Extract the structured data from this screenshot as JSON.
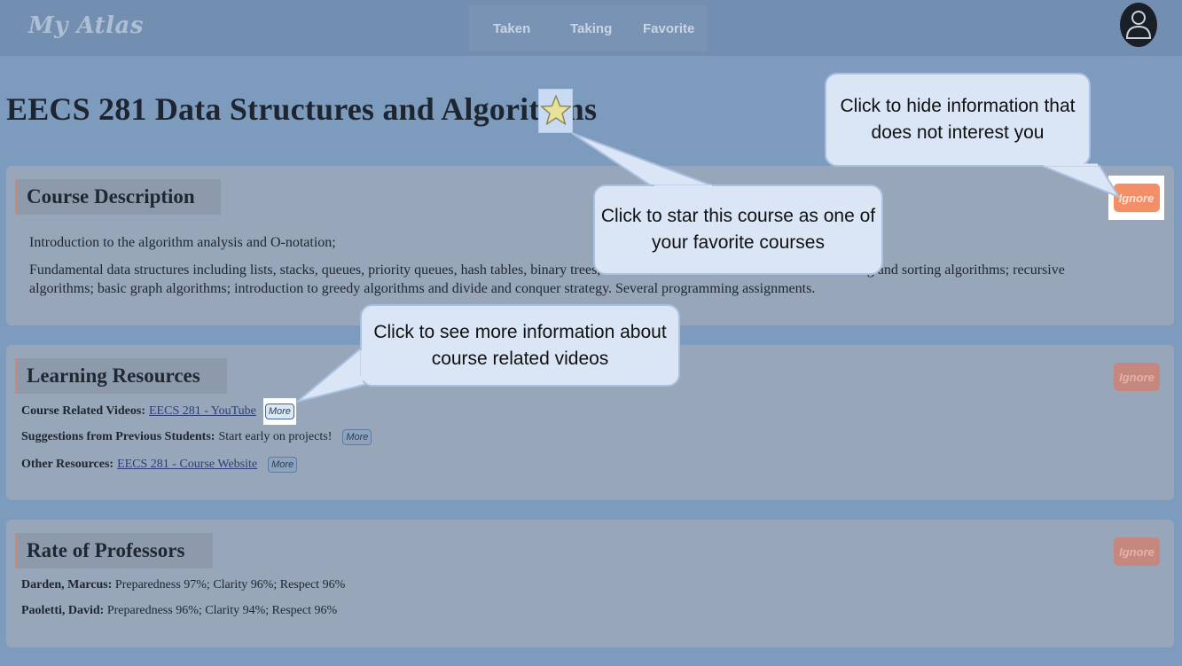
{
  "header": {
    "logo": "My Atlas",
    "tabs": [
      {
        "label": "Taken"
      },
      {
        "label": "Taking"
      },
      {
        "label": "Favorite"
      }
    ]
  },
  "course": {
    "title": "EECS 281 Data Structures and Algorithms"
  },
  "sections": {
    "description": {
      "heading": "Course Description",
      "ignore_label": "Ignore",
      "para1": "Introduction to the algorithm analysis and O-notation;",
      "para2_line1_a": "Fundamental data structures including lists, stacks, queues, priority queues, hash tables, binary trees,",
      "para2_line1_b": "ing and sorting algorithms; recursive",
      "para2_line2": "algorithms; basic graph algorithms; introduction to greedy algorithms and divide and conquer strategy. Several programming assignments."
    },
    "resources": {
      "heading": "Learning Resources",
      "ignore_label": "Ignore",
      "items": [
        {
          "label": "Course Related Videos:",
          "value": "EECS 281 - YouTube",
          "more": "More"
        },
        {
          "label": "Suggestions from Previous Students:",
          "value": "Start early on projects!",
          "more": "More"
        },
        {
          "label": "Other Resources:",
          "value": "EECS 281 - Course Website",
          "more": "More"
        }
      ]
    },
    "professors": {
      "heading": "Rate of Professors",
      "ignore_label": "Ignore",
      "items": [
        {
          "name": "Darden, Marcus:",
          "ratings": "Preparedness 97%; Clarity 96%; Respect 96%"
        },
        {
          "name": "Paoletti, David:",
          "ratings": "Preparedness 96%; Clarity 94%; Respect 96%"
        }
      ]
    }
  },
  "callouts": {
    "ignore": "Click to hide information that does not interest you",
    "star": "Click to star this course as one of your favorite courses",
    "more": "Click to see more information about course related videos"
  },
  "colors": {
    "background": "#7d9cbd",
    "section": "#97a6b8",
    "accent": "#c78a7a",
    "callout": "#dae5f5"
  }
}
